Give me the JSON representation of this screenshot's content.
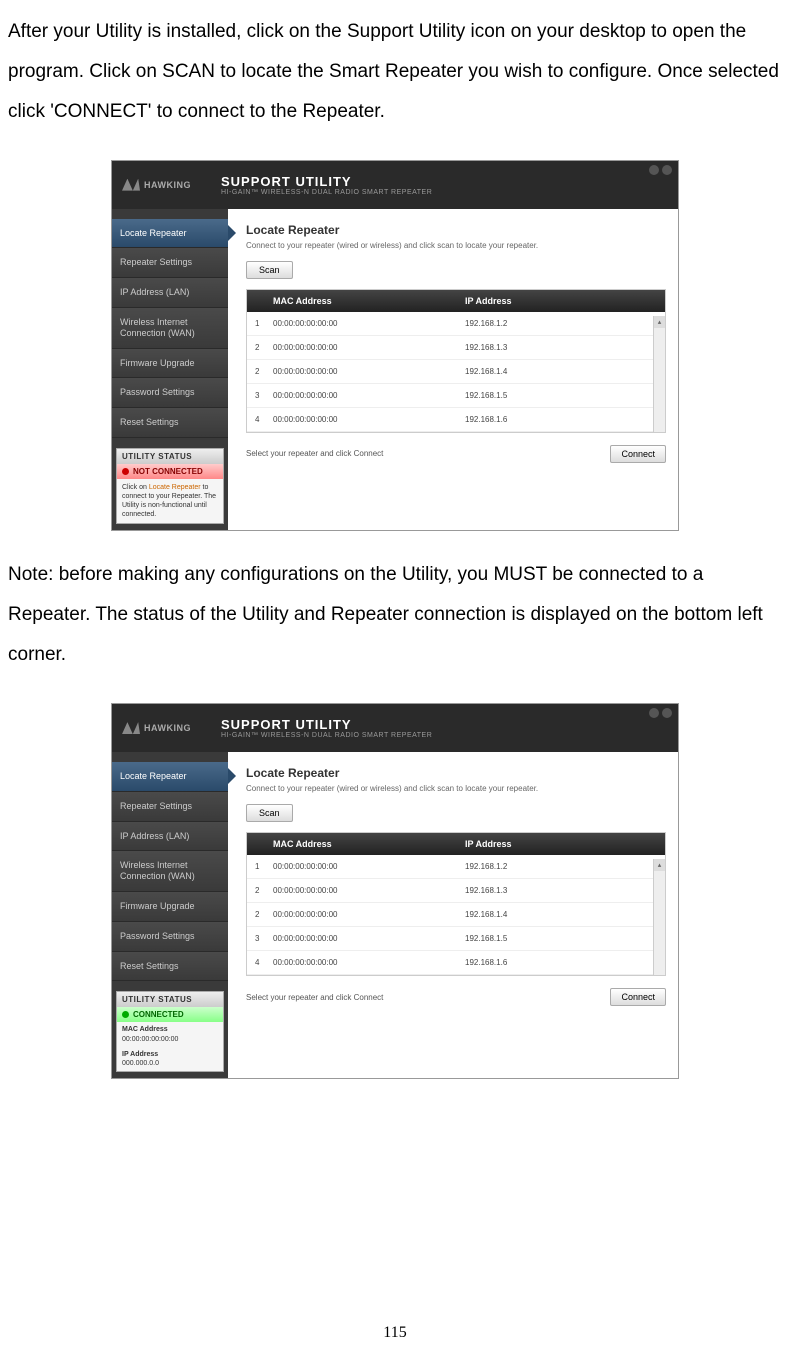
{
  "doc": {
    "para1": "After your Utility is installed, click on the Support Utility icon on your desktop to open the program.   Click on SCAN to locate the Smart Repeater you wish to configure.   Once selected click 'CONNECT' to connect to the Repeater.",
    "para2": "Note: before making any configurations on the Utility, you MUST be connected to a Repeater.   The status of the Utility and Repeater connection is displayed on the bottom left corner.",
    "page_number": "115"
  },
  "app": {
    "logo_text": "HAWKING",
    "title": "SUPPORT UTILITY",
    "subtitle": "HI-GAIN™ WIRELESS-N DUAL RADIO SMART REPEATER",
    "sidebar": [
      {
        "label": "Locate Repeater",
        "active": true
      },
      {
        "label": "Repeater Settings"
      },
      {
        "label": "IP Address (LAN)"
      },
      {
        "label": "Wireless Internet Connection (WAN)"
      },
      {
        "label": "Firmware Upgrade"
      },
      {
        "label": "Password Settings"
      },
      {
        "label": "Reset Settings"
      }
    ],
    "status": {
      "header": "UTILITY STATUS",
      "not_connected_label": "NOT CONNECTED",
      "not_connected_desc_prefix": "Click on ",
      "not_connected_desc_highlight": "Locate Repeater",
      "not_connected_desc_suffix": " to connect to your Repeater. The Utility is non-functional until connected.",
      "connected_label": "CONNECTED",
      "mac_label": "MAC Address",
      "mac_value": "00:00:00:00:00:00",
      "ip_label": "IP Address",
      "ip_value": "000.000.0.0"
    },
    "main": {
      "title": "Locate Repeater",
      "desc": "Connect to your repeater (wired or wireless) and click scan to locate your repeater.",
      "scan_label": "Scan",
      "th_mac": "MAC Address",
      "th_ip": "IP Address",
      "rows": [
        {
          "idx": "1",
          "mac": "00:00:00:00:00:00",
          "ip": "192.168.1.2"
        },
        {
          "idx": "2",
          "mac": "00:00:00:00:00:00",
          "ip": "192.168.1.3"
        },
        {
          "idx": "2",
          "mac": "00:00:00:00:00:00",
          "ip": "192.168.1.4"
        },
        {
          "idx": "3",
          "mac": "00:00:00:00:00:00",
          "ip": "192.168.1.5"
        },
        {
          "idx": "4",
          "mac": "00:00:00:00:00:00",
          "ip": "192.168.1.6"
        }
      ],
      "footer_text": "Select your repeater and click Connect",
      "connect_label": "Connect"
    }
  }
}
